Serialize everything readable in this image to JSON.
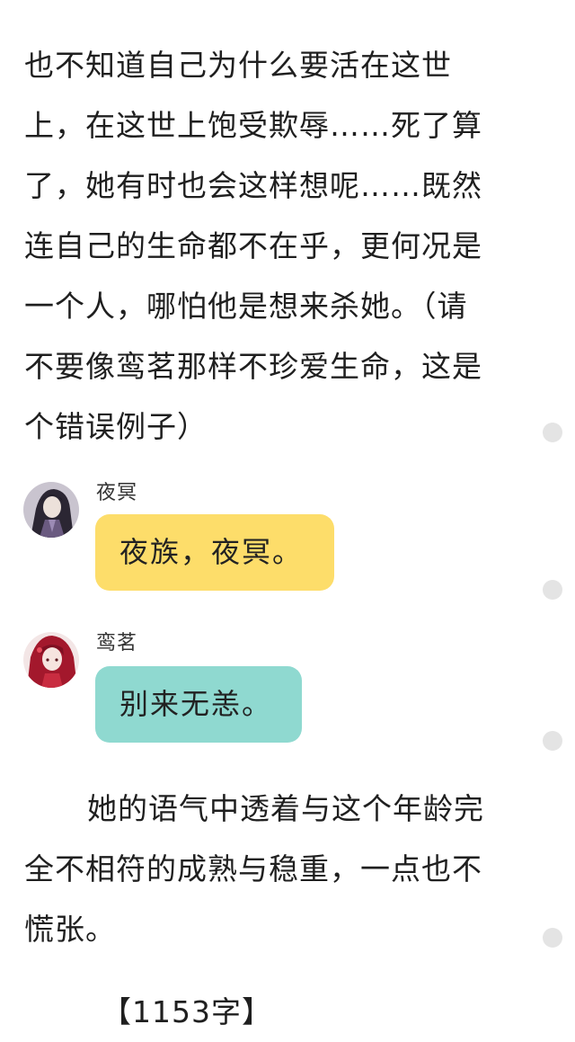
{
  "story": {
    "intro_lines": [
      "也不知道自己为什么要活在这世",
      "上，在这世上饱受欺辱……死了算",
      "了，她有时也会这样想呢……既然",
      "连自己的生命都不在乎，更何况是",
      "一个人，哪怕他是想来杀她。（请",
      "不要像鸾茗那样不珍爱生命，这是",
      "个错误例子）"
    ],
    "ending_lines": [
      "她的语气中透着与这个年龄完",
      "全不相符的成熟与稳重，一点也不",
      "慌张。"
    ],
    "word_count": "【1153字】"
  },
  "dialogue": [
    {
      "speaker": "夜冥",
      "text": "夜族，夜冥。",
      "bubble_color": "#fddd6a",
      "avatar": "dark-haired-character-avatar"
    },
    {
      "speaker": "鸾茗",
      "text": "别来无恙。",
      "bubble_color": "#8fd9d0",
      "avatar": "red-haired-character-avatar"
    }
  ],
  "colors": {
    "text": "#1f1f1f",
    "side_dot": "#e4e4e4"
  }
}
